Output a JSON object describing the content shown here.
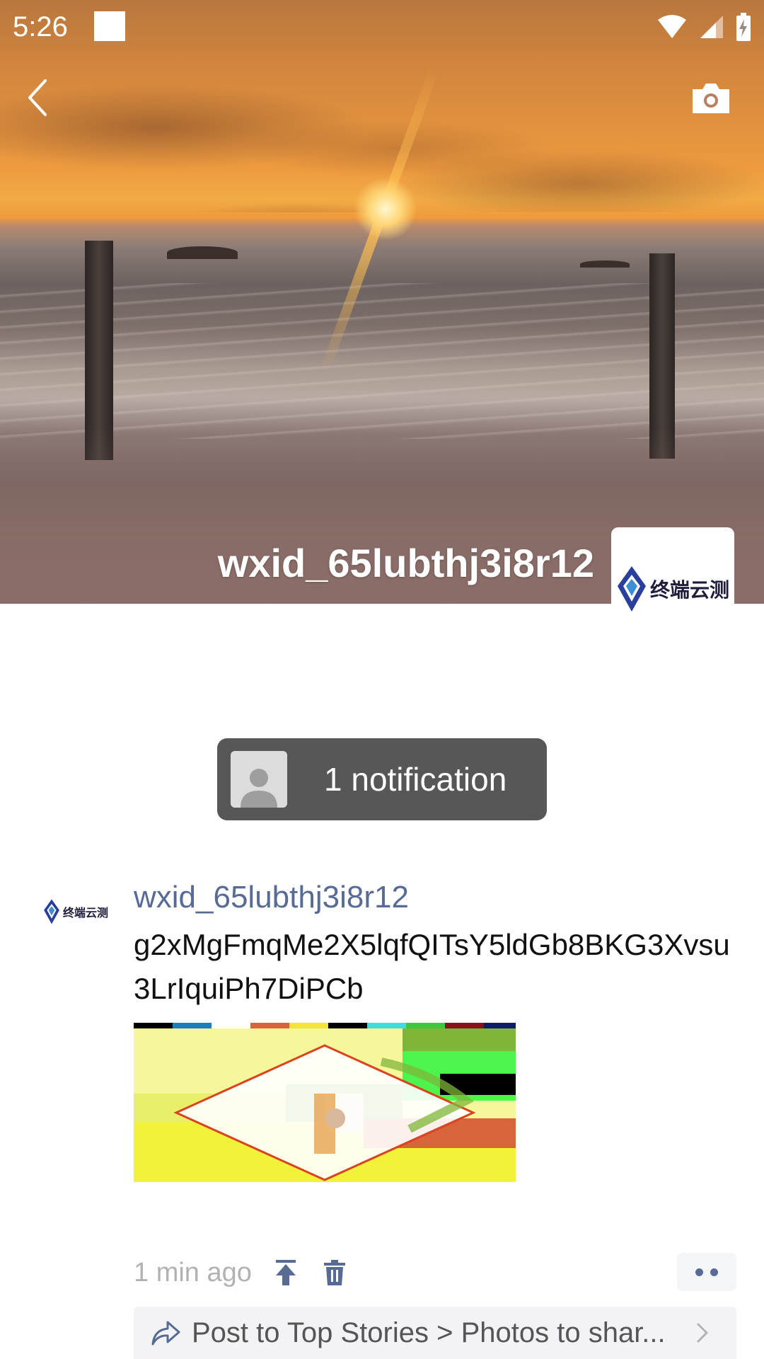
{
  "status_bar": {
    "time": "5:26",
    "icons": [
      "wifi-icon",
      "cell-signal-icon",
      "battery-charging-icon"
    ]
  },
  "header": {
    "back_icon": "chevron-left-icon",
    "camera_icon": "camera-icon"
  },
  "profile": {
    "name": "wxid_65lubthj3i8r12",
    "avatar_logo_text": "终端云测"
  },
  "notification": {
    "text": "1 notification"
  },
  "post": {
    "author": "wxid_65lubthj3i8r12",
    "text": "g2xMgFmqMe2X5lqfQITsY5ldGb8BKG3Xvsu3LrIquiPh7DiPCb",
    "time": "1 min ago",
    "share_text": "Post to Top Stories > Photos to shar..."
  },
  "colors": {
    "link_blue": "#576b95",
    "notification_bg": "#575757",
    "timestamp_gray": "#b2b2b2"
  }
}
